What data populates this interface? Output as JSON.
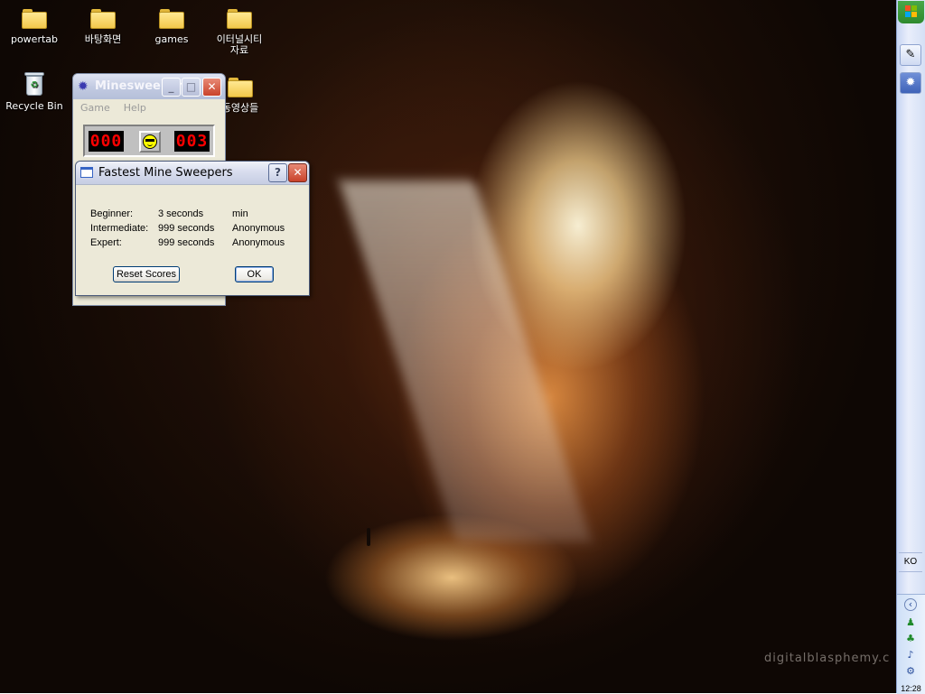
{
  "desktop": {
    "icons": [
      {
        "label": "powertab",
        "icon": "folder-icon"
      },
      {
        "label": "바탕화면",
        "icon": "folder-icon"
      },
      {
        "label": "games",
        "icon": "folder-icon"
      },
      {
        "label": "이터널시티 자료",
        "icon": "folder-icon"
      },
      {
        "label": "Recycle Bin",
        "icon": "recycle-bin-icon"
      },
      {
        "label": "동영상들",
        "icon": "folder-icon"
      }
    ],
    "watermark": "digitalblasphemy.c"
  },
  "minesweeper": {
    "title": "Minesweeper",
    "title_display": "Minesweeper…",
    "menu": [
      "Game",
      "Help"
    ],
    "mine_counter": "000",
    "timer": "003",
    "face": "sunglasses-smiley-icon"
  },
  "dialog": {
    "title": "Fastest Mine Sweepers",
    "rows": [
      {
        "level": "Beginner:",
        "time": "3 seconds",
        "name": "min"
      },
      {
        "level": "Intermediate:",
        "time": "999 seconds",
        "name": "Anonymous"
      },
      {
        "level": "Expert:",
        "time": "999 seconds",
        "name": "Anonymous"
      }
    ],
    "reset_label": "Reset Scores",
    "ok_label": "OK",
    "help_glyph": "?",
    "close_glyph": "✕"
  },
  "taskbar": {
    "language": "KO",
    "clock": "12:28",
    "quick_launch": [
      "show-desktop-icon",
      "minesweeper-task-icon"
    ],
    "tray_icons": [
      "chevron-left-icon",
      "messenger-icon",
      "network-icon",
      "volume-icon",
      "security-icon"
    ]
  },
  "colors": {
    "lcd_red": "#ff0000",
    "xp_start_green": "#3a9b3a",
    "dialog_face": "#ece9d8"
  }
}
